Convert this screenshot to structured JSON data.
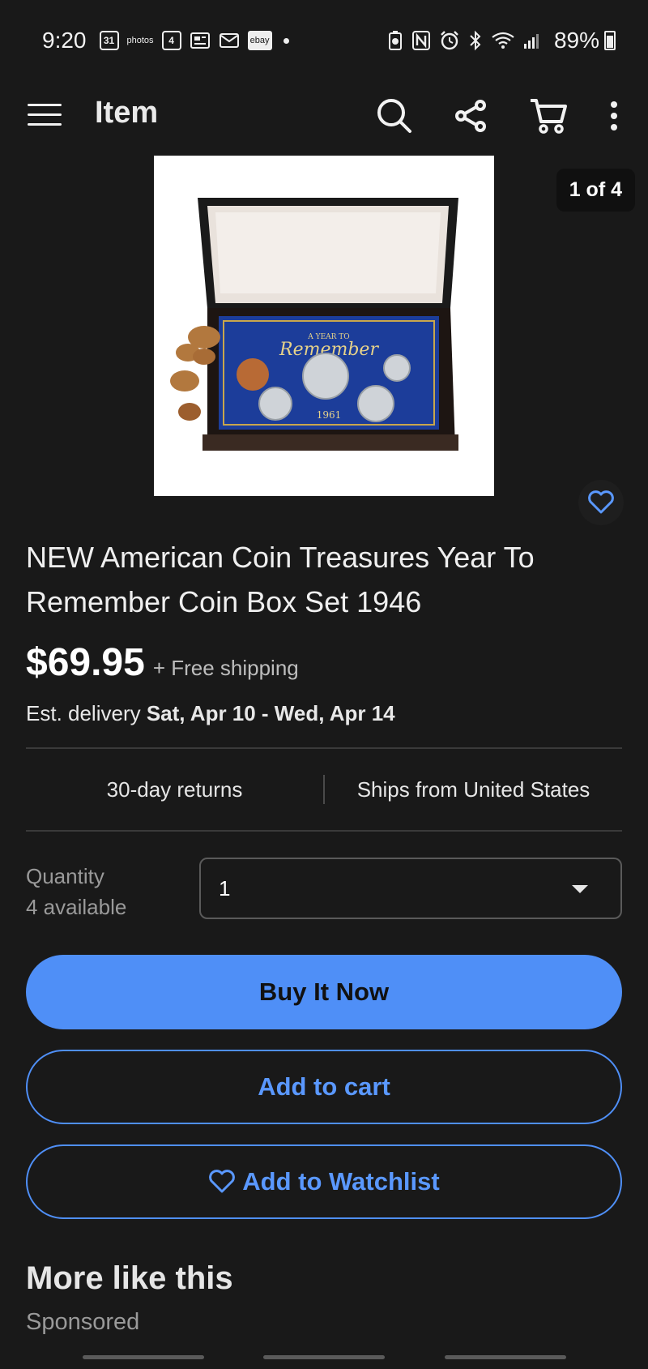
{
  "status_bar": {
    "time": "9:20",
    "calendar_date": "31",
    "photos_label": "photos",
    "news_count": "4",
    "ebay_label": "ebay",
    "battery": "89%"
  },
  "app_bar": {
    "title": "Item"
  },
  "gallery": {
    "counter": "1 of 4"
  },
  "product": {
    "title": "NEW American Coin Treasures Year To Remember Coin Box Set 1946",
    "price": "$69.95",
    "shipping": "+ Free shipping",
    "delivery_label": "Est. delivery",
    "delivery_dates": "Sat, Apr 10 - Wed, Apr 14",
    "image_text_top": "A YEAR TO",
    "image_text_script": "Remember",
    "image_year": "1961"
  },
  "features": {
    "returns": "30-day returns",
    "ships_from": "Ships from United States"
  },
  "quantity": {
    "label": "Quantity",
    "available": "4 available",
    "value": "1"
  },
  "actions": {
    "buy_now": "Buy It Now",
    "add_to_cart": "Add to cart",
    "add_to_watchlist": "Add to Watchlist"
  },
  "more": {
    "title": "More like this",
    "sponsored": "Sponsored"
  },
  "colors": {
    "background": "#191919",
    "accent": "#4f8ff7"
  }
}
